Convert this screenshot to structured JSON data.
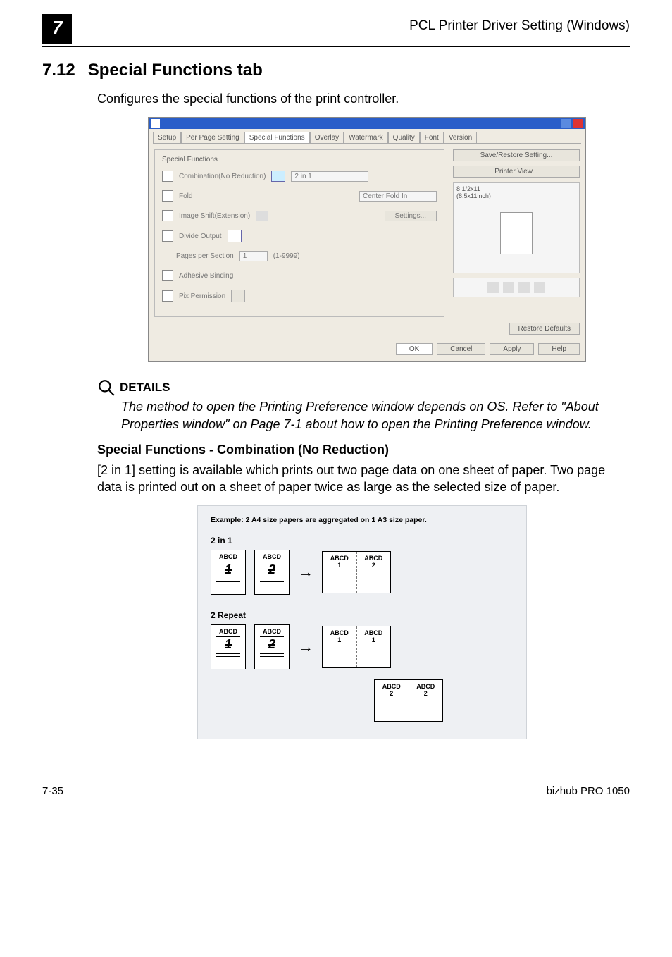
{
  "header": {
    "chapter": "7",
    "breadcrumb": "PCL Printer Driver Setting (Windows)"
  },
  "section": {
    "number": "7.12",
    "title": "Special Functions tab",
    "intro": "Configures the special functions of the print controller."
  },
  "dialog": {
    "tabs": [
      "Setup",
      "Per Page Setting",
      "Special Functions",
      "Overlay",
      "Watermark",
      "Quality",
      "Font",
      "Version"
    ],
    "active_tab": "Special Functions",
    "group": "Special Functions",
    "rows": {
      "combination": {
        "label": "Combination(No Reduction)",
        "value": "2 in 1"
      },
      "fold": {
        "label": "Fold",
        "value": "Center Fold In"
      },
      "image_shift": {
        "label": "Image Shift(Extension)",
        "btn": "Settings..."
      },
      "divide": {
        "label": "Divide Output"
      },
      "pages_per_section": {
        "label": "Pages per Section",
        "value": "1",
        "unit": "(1-9999)"
      },
      "adhesive": {
        "label": "Adhesive Binding"
      },
      "pix_permission": {
        "label": "Pix Permission"
      }
    },
    "right": {
      "save_restore": "Save/Restore Setting...",
      "printer_view": "Printer View...",
      "paper1": "8 1/2x11",
      "paper2": "(8.5x11inch)",
      "restore": "Restore Defaults"
    },
    "footer": {
      "ok": "OK",
      "cancel": "Cancel",
      "apply": "Apply",
      "help": "Help"
    }
  },
  "details": {
    "heading": "DETAILS",
    "body": "The method to open the Printing Preference window depends on OS. Refer to \"About Properties window\" on Page 7-1 about how to open the Printing Preference window."
  },
  "sub": {
    "heading": "Special Functions - Combination (No Reduction)",
    "body": "[2 in 1] setting is available which prints out two page data on one sheet of paper. Two page data is printed out on a sheet of paper twice as large as the selected size of paper."
  },
  "diagram": {
    "caption": "Example: 2 A4 size papers are aggregated on 1 A3 size paper.",
    "mode1": "2 in 1",
    "mode2": "2 Repeat",
    "abcd": "ABCD",
    "n1": "1",
    "n2": "2"
  },
  "footer": {
    "left": "7-35",
    "right": "bizhub PRO 1050"
  }
}
